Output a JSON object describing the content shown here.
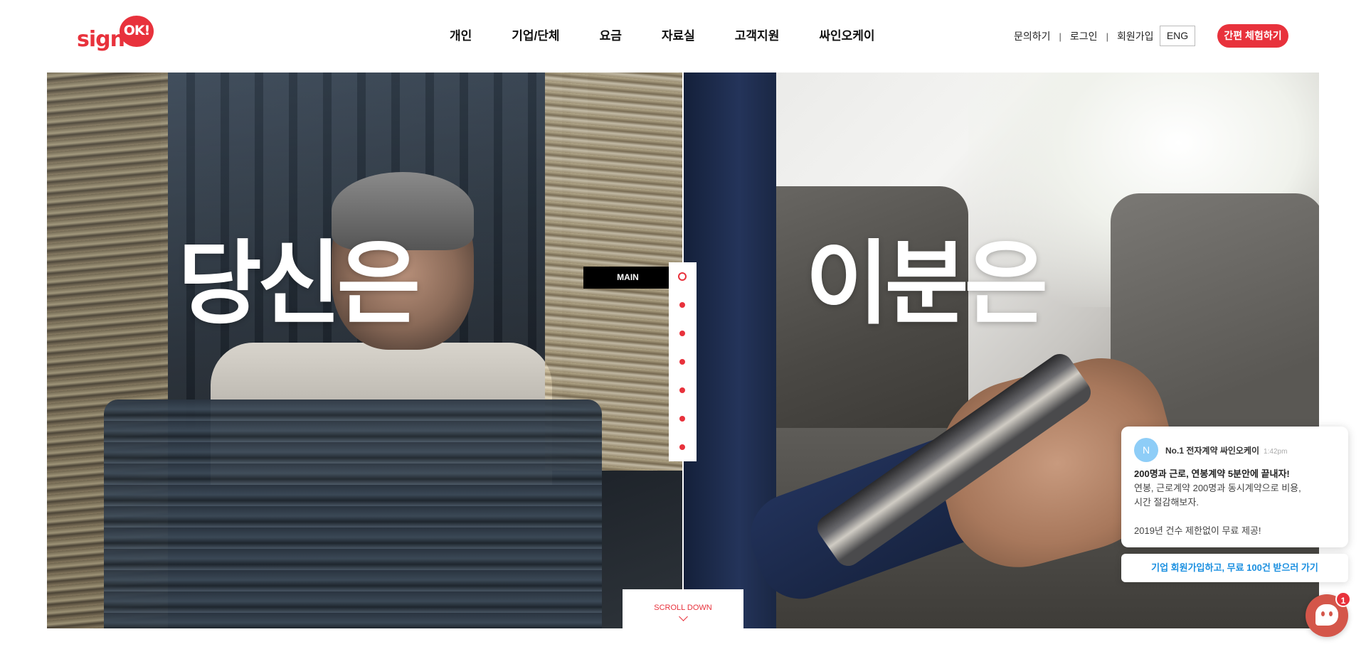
{
  "brand": {
    "logo_word": "sign",
    "logo_badge": "OK!",
    "accent_color": "#e8323c"
  },
  "nav": {
    "items": [
      {
        "label": "개인"
      },
      {
        "label": "기업/단체"
      },
      {
        "label": "요금"
      },
      {
        "label": "자료실"
      },
      {
        "label": "고객지원"
      },
      {
        "label": "싸인오케이"
      }
    ]
  },
  "util": {
    "inquiry": "문의하기",
    "login": "로그인",
    "signup": "회원가입",
    "separator": "|",
    "language": "ENG",
    "trial_button": "간편 체험하기"
  },
  "hero": {
    "left_text": "당신은",
    "right_text": "이분은",
    "section_label": "MAIN",
    "scroll_label": "SCROLL DOWN"
  },
  "chat": {
    "avatar_letter": "N",
    "sender": "No.1 전자계약 싸인오케이",
    "time": "1:42pm",
    "headline": "200명과 근로, 연봉계약 5분안에 끝내자!",
    "line1": "연봉, 근로계약 200명과 동시계약으로 비용,",
    "line2": "시간 절감해보자.",
    "line3": "2019년 건수 제한없이 무료 제공!",
    "cta": "기업 회원가입하고, 무료 100건 받으러 가기",
    "badge_count": "1"
  }
}
